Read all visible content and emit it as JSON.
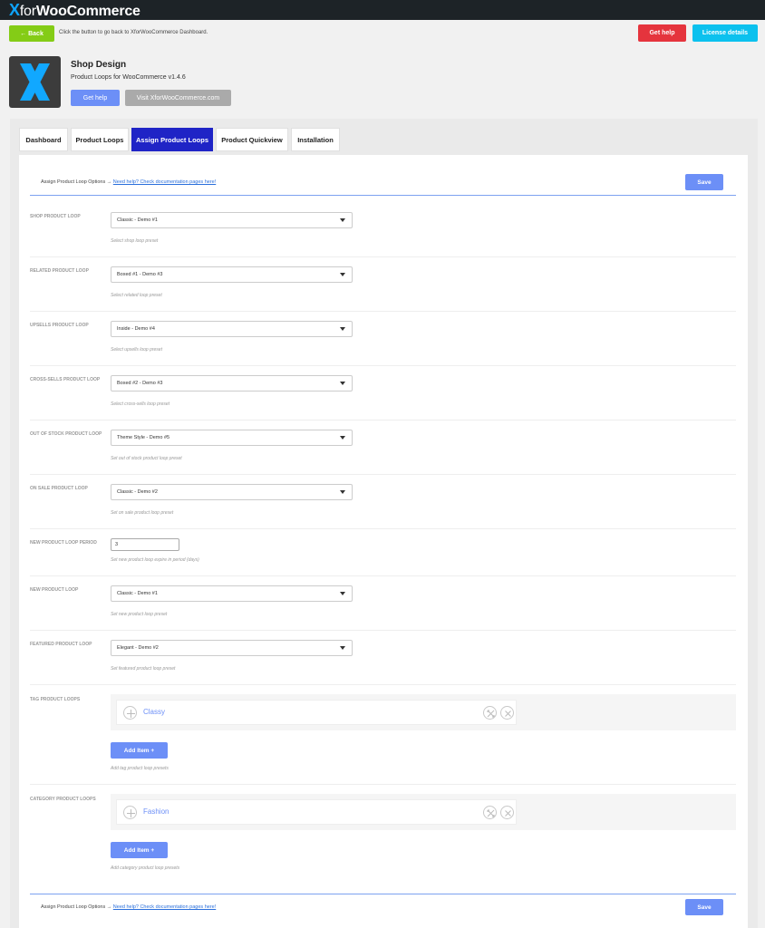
{
  "brand": {
    "x": "X",
    "for": "for",
    "name": "WooCommerce"
  },
  "nav": {
    "back_label": "← Back",
    "back_hint": "Click the button to go back to XforWooCommerce Dashboard.",
    "get_help": "Get help",
    "license": "License details"
  },
  "plugin": {
    "title": "Shop Design",
    "subtitle": "Product Loops for WooCommerce v1.4.6",
    "get_help": "Get help",
    "visit": "Visit XforWooCommerce.com"
  },
  "tabs": [
    {
      "label": "Dashboard"
    },
    {
      "label": "Product Loops"
    },
    {
      "label": "Assign Product Loops"
    },
    {
      "label": "Product Quickview"
    },
    {
      "label": "Installation"
    }
  ],
  "options_bar": {
    "text": "Assign Product Loop Options →",
    "link": "Need help? Check documentation pages here!",
    "save": "Save"
  },
  "fields": [
    {
      "label": "SHOP PRODUCT LOOP",
      "value": "Classic - Demo #1",
      "hint": "Select shop loop preset"
    },
    {
      "label": "RELATED PRODUCT LOOP",
      "value": "Boxed #1 - Demo #3",
      "hint": "Select related loop preset"
    },
    {
      "label": "UPSELLS PRODUCT LOOP",
      "value": "Inside - Demo #4",
      "hint": "Select upsells loop preset"
    },
    {
      "label": "CROSS-SELLS PRODUCT LOOP",
      "value": "Boxed #2 - Demo #3",
      "hint": "Select cross-sells loop preset"
    },
    {
      "label": "OUT OF STOCK PRODUCT LOOP",
      "value": "Theme Style - Demo #5",
      "hint": "Set out of stock product loop preset"
    },
    {
      "label": "ON SALE PRODUCT LOOP",
      "value": "Classic - Demo #2",
      "hint": "Set on sale product loop preset"
    },
    {
      "label": "NEW PRODUCT LOOP PERIOD",
      "value": "3",
      "hint": "Set new product loop expire in period (days)"
    },
    {
      "label": "NEW PRODUCT LOOP",
      "value": "Classic - Demo #1",
      "hint": "Set new product loop preset"
    },
    {
      "label": "FEATURED PRODUCT LOOP",
      "value": "Elegant - Demo #2",
      "hint": "Set featured product loop preset"
    }
  ],
  "tag_loops": {
    "label": "TAG PRODUCT LOOPS",
    "item": "Classy",
    "add": "Add Item +",
    "hint": "Add tag product loop presets"
  },
  "cat_loops": {
    "label": "CATEGORY PRODUCT LOOPS",
    "item": "Fashion",
    "add": "Add Item +",
    "hint": "Add category product loop presets"
  }
}
